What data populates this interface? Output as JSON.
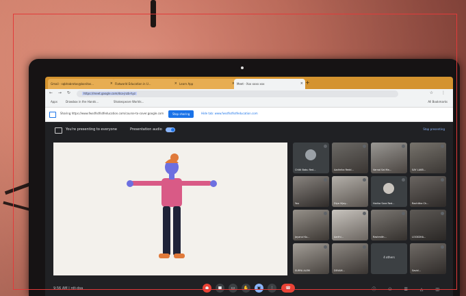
{
  "browser": {
    "tabs": [
      {
        "label": "Gmail - sqbhabrotas@bonitas...",
        "active": false
      },
      {
        "label": "Flatworld Education in U...",
        "active": false
      },
      {
        "label": "Learn App",
        "active": false
      },
      {
        "label": "Meet - Xxx xxxx xxx",
        "active": true
      }
    ],
    "address": "https://meet.google.com/dsa-jnzb-hyz",
    "bookmarks": [
      "Apps",
      "Drawbox in the Hands...",
      "Shakespeare Worlds..."
    ],
    "all_bookmarks": "All Bookmarks"
  },
  "sharebar": {
    "text": "Sharing https://www.fwsdfsdfsdfeducation.com/course-to-cover.google.com",
    "stop_button": "Stop sharing",
    "view_tab": "Hide tab: www.fwsdfsdfsdfeducation.com"
  },
  "meet": {
    "presenting_text": "You're presenting to everyone",
    "audio_label": "Presentation audio",
    "stop_presenting": "Stop presenting",
    "clock": "9:56 AM",
    "meeting_code": "rdt-dsa"
  },
  "participants": [
    {
      "name": "Chitti Babu Red..."
    },
    {
      "name": "Aadhrika Redd..."
    },
    {
      "name": "Varnal Sai Ma..."
    },
    {
      "name": "SAY LAKB..."
    },
    {
      "name": "You"
    },
    {
      "name": "Diya Vijay..."
    },
    {
      "name": "Harika Sara Red..."
    },
    {
      "name": "Rachitha Ch..."
    },
    {
      "name": "Jayanvi Ku..."
    },
    {
      "name": "Aarthi..."
    },
    {
      "name": "Rashmith..."
    },
    {
      "name": "LOCKDHA..."
    },
    {
      "name": "SURYA ALEM"
    },
    {
      "name": "DEVAM..."
    },
    {
      "name": "4 others"
    },
    {
      "name": "Savid..."
    }
  ],
  "colors": {
    "wall": "#c4705f",
    "frame": "#e23a3a",
    "meet_bg": "#202124",
    "accent": "#1a73e8",
    "end_call": "#e94235"
  }
}
